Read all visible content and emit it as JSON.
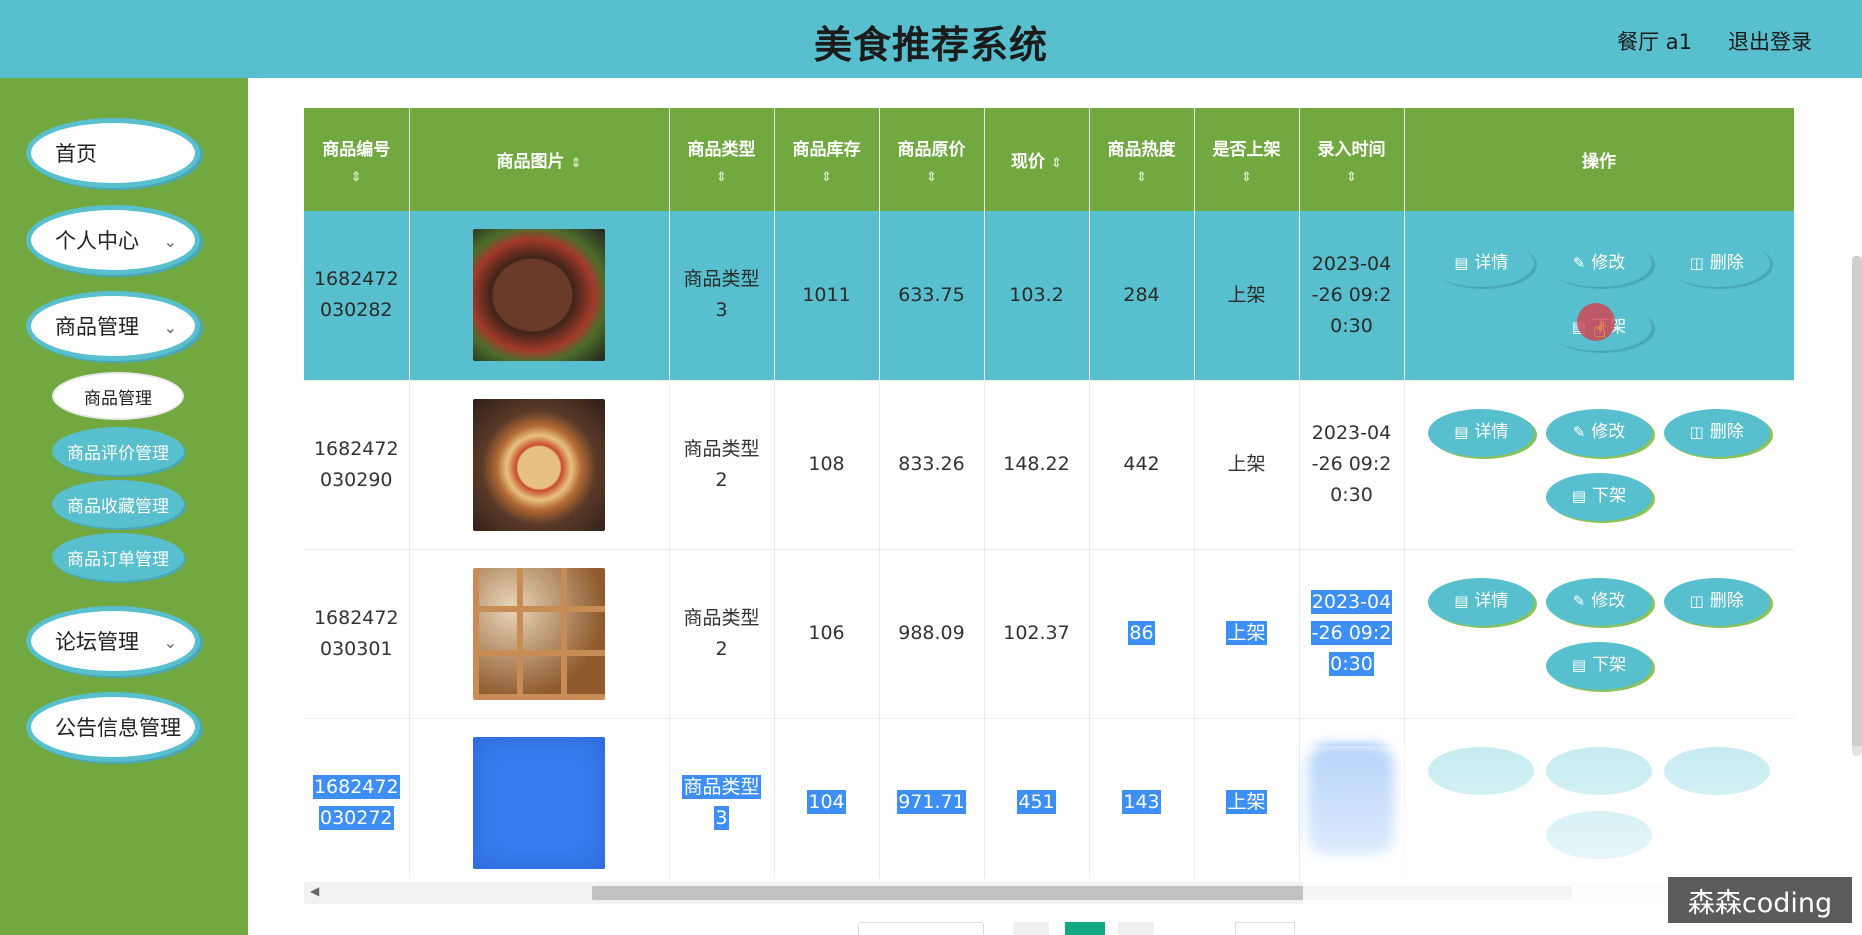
{
  "header": {
    "title": "美食推荐系统",
    "user": "餐厅 a1",
    "logout": "退出登录"
  },
  "sidebar": {
    "items": [
      {
        "label": "首页"
      },
      {
        "label": "个人中心"
      },
      {
        "label": "商品管理"
      },
      {
        "label": "论坛管理"
      },
      {
        "label": "公告信息管理"
      }
    ],
    "subitems": [
      {
        "label": "商品管理"
      },
      {
        "label": "商品评价管理"
      },
      {
        "label": "商品收藏管理"
      },
      {
        "label": "商品订单管理"
      }
    ]
  },
  "table": {
    "columns": [
      "商品编号",
      "商品图片",
      "商品类型",
      "商品库存",
      "商品原价",
      "现价",
      "商品热度",
      "是否上架",
      "录入时间",
      "操作"
    ],
    "rows": [
      {
        "id_a": "1682472",
        "id_b": "030282",
        "image": "steak",
        "type_a": "商品类型",
        "type_b": "3",
        "stock": "1011",
        "orig_price": "633.75",
        "price": "103.2",
        "hot": "284",
        "status": "上架",
        "time_a": "2023-04",
        "time_b": "-26 09:2",
        "time_c": "0:30"
      },
      {
        "id_a": "1682472",
        "id_b": "030290",
        "image": "pizza",
        "type_a": "商品类型",
        "type_b": "2",
        "stock": "108",
        "orig_price": "833.26",
        "price": "148.22",
        "hot": "442",
        "status": "上架",
        "time_a": "2023-04",
        "time_b": "-26 09:2",
        "time_c": "0:30"
      },
      {
        "id_a": "1682472",
        "id_b": "030301",
        "image": "bento",
        "type_a": "商品类型",
        "type_b": "2",
        "stock": "106",
        "orig_price": "988.09",
        "price": "102.37",
        "hot": "86",
        "status": "上架",
        "time_a": "2023-04",
        "time_b": "-26 09:2",
        "time_c": "0:30"
      },
      {
        "id_a": "1682472",
        "id_b": "030272",
        "image": "blue",
        "type_a": "商品类型",
        "type_b": "3",
        "stock": "104",
        "orig_price": "971.71",
        "price": "451",
        "hot": "143",
        "status": "上架"
      }
    ],
    "actions": {
      "detail": "详情",
      "edit": "修改",
      "delete": "删除",
      "offshelf": "下架"
    }
  },
  "watermark": "森森coding"
}
